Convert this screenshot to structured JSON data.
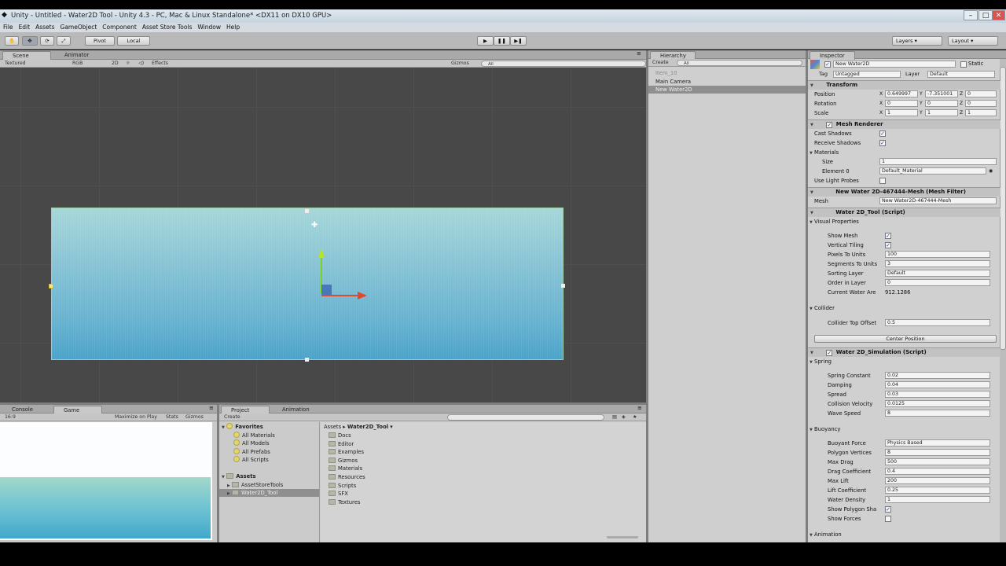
{
  "window": {
    "title": "Unity - Untitled - Water2D Tool - Unity 4.3 - PC, Mac & Linux Standalone* <DX11 on DX10 GPU>"
  },
  "menu": [
    "File",
    "Edit",
    "Assets",
    "GameObject",
    "Component",
    "Asset Store Tools",
    "Window",
    "Help"
  ],
  "toolbar": {
    "pivot": "Pivot",
    "local": "Local",
    "layers": "Layers",
    "layout": "Layout"
  },
  "scene": {
    "tab": "Scene",
    "tab2": "Animator",
    "render_mode": "Textured",
    "color_mode": "RGB",
    "mode2d": "2D",
    "effects": "Effects",
    "gizmos": "Gizmos",
    "search_placeholder": "All"
  },
  "hierarchy": {
    "tab": "Hierarchy",
    "create": "Create",
    "search_placeholder": "All",
    "items": [
      "Item_10",
      "Main Camera",
      "New Water2D"
    ]
  },
  "inspector": {
    "tab": "Inspector",
    "object_name": "New Water2D",
    "static": "Static",
    "tag_label": "Tag",
    "tag": "Untagged",
    "layer_label": "Layer",
    "layer": "Default",
    "transform": {
      "title": "Transform",
      "position_label": "Position",
      "rotation_label": "Rotation",
      "scale_label": "Scale",
      "position": [
        "0.649997",
        "-7.351001",
        "0"
      ],
      "rotation": [
        "0",
        "0",
        "0"
      ],
      "scale": [
        "1",
        "1",
        "1"
      ]
    },
    "mesh_renderer": {
      "title": "Mesh Renderer",
      "cast_shadows": "Cast Shadows",
      "receive_shadows": "Receive Shadows",
      "materials": "Materials",
      "size_label": "Size",
      "size": "1",
      "element0_label": "Element 0",
      "element0": "Default_Material",
      "light_probes": "Use Light Probes"
    },
    "mesh_filter": {
      "title": "New Water 2D-467444-Mesh (Mesh Filter)",
      "mesh_label": "Mesh",
      "mesh": "New Water2D-467444-Mesh"
    },
    "water_tool": {
      "title": "Water 2D_Tool (Script)",
      "visual": "Visual Properties",
      "show_mesh": "Show Mesh",
      "vertical_tiling": "Vertical Tiling",
      "ppu_label": "Pixels To Units",
      "ppu": "100",
      "stu_label": "Segments To Units",
      "stu": "3",
      "sorting_label": "Sorting Layer",
      "sorting": "Default",
      "order_label": "Order in Layer",
      "order": "0",
      "area_label": "Current Water Are",
      "area": "912.1286",
      "collider": "Collider",
      "top_offset_label": "Collider Top Offset",
      "top_offset": "0.5",
      "center_btn": "Center Position"
    },
    "simulation": {
      "title": "Water 2D_Simulation (Script)",
      "spring": "Spring",
      "spring_const_label": "Spring Constant",
      "spring_const": "0.02",
      "damping_label": "Damping",
      "damping": "0.04",
      "spread_label": "Spread",
      "spread": "0.03",
      "collision_label": "Collision Velocity",
      "collision": "0.0125",
      "wave_label": "Wave Speed",
      "wave": "8",
      "buoyancy": "Buoyancy",
      "force_label": "Buoyant Force",
      "force": "Physics Based",
      "poly_label": "Polygon Vertices",
      "poly": "8",
      "maxdrag_label": "Max Drag",
      "maxdrag": "500",
      "dragcoef_label": "Drag Coefficient",
      "dragcoef": "0.4",
      "maxlift_label": "Max Lift",
      "maxlift": "200",
      "liftcoef_label": "Lift Coefficient",
      "liftcoef": "0.25",
      "density_label": "Water Density",
      "density": "1",
      "showpoly_label": "Show Polygon Sha",
      "showforces_label": "Show Forces",
      "animation": "Animation"
    }
  },
  "game": {
    "tab_console": "Console",
    "tab_game": "Game",
    "aspect": "16:9",
    "maximize": "Maximize on Play",
    "stats": "Stats",
    "gizmos": "Gizmos"
  },
  "project": {
    "tab": "Project",
    "tab2": "Animation",
    "create": "Create",
    "favorites": "Favorites",
    "fav_items": [
      "All Materials",
      "All Models",
      "All Prefabs",
      "All Scripts"
    ],
    "assets": "Assets",
    "asset_items": [
      "AssetStoreTools",
      "Water2D_Tool"
    ],
    "breadcrumb_root": "Assets",
    "breadcrumb_folder": "Water2D_Tool",
    "folders": [
      "Docs",
      "Editor",
      "Examples",
      "Gizmos",
      "Materials",
      "Resources",
      "Scripts",
      "SFX",
      "Textures"
    ]
  },
  "colors": {
    "accent": "#3e6db5",
    "water_top": "#a6d7d9",
    "water_bottom": "#4ba3c9"
  }
}
